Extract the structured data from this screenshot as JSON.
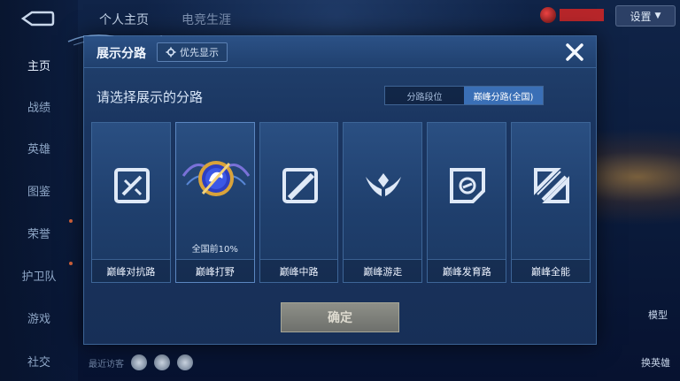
{
  "sidebar": {
    "items": [
      {
        "label": "主页",
        "active": true
      },
      {
        "label": "战绩",
        "active": false
      },
      {
        "label": "英雄",
        "active": false
      },
      {
        "label": "图鉴",
        "active": false
      },
      {
        "label": "荣誉",
        "active": false
      },
      {
        "label": "护卫队",
        "active": false
      },
      {
        "label": "游戏",
        "active": false
      },
      {
        "label": "社交",
        "active": false
      }
    ]
  },
  "top_tabs": [
    "个人主页",
    "电竞生涯"
  ],
  "header_right": {
    "settings_label": "设置"
  },
  "right_side": {
    "model_label": "模型",
    "switch_hero_label": "换英雄"
  },
  "bottom": {
    "visitors_label": "最近访客"
  },
  "modal": {
    "title": "展示分路",
    "priority_label": "优先显示",
    "subtitle": "请选择展示的分路",
    "segments": [
      {
        "label": "分路段位",
        "active": false
      },
      {
        "label": "巅峰分路(全国)",
        "active": true
      }
    ],
    "cards": [
      {
        "label": "巅峰对抗路",
        "icon": "clash-lane-icon",
        "percent": ""
      },
      {
        "label": "巅峰打野",
        "icon": "jungle-emblem-icon",
        "percent": "全国前10%"
      },
      {
        "label": "巅峰中路",
        "icon": "mid-lane-icon",
        "percent": ""
      },
      {
        "label": "巅峰游走",
        "icon": "roam-wings-icon",
        "percent": ""
      },
      {
        "label": "巅峰发育路",
        "icon": "farm-lane-icon",
        "percent": ""
      },
      {
        "label": "巅峰全能",
        "icon": "all-round-icon",
        "percent": ""
      }
    ],
    "confirm_label": "确定"
  },
  "colors": {
    "accent": "#3a6fb6",
    "modal_bg": "#1a3560",
    "confirm_bg": "#7e7f7a"
  }
}
